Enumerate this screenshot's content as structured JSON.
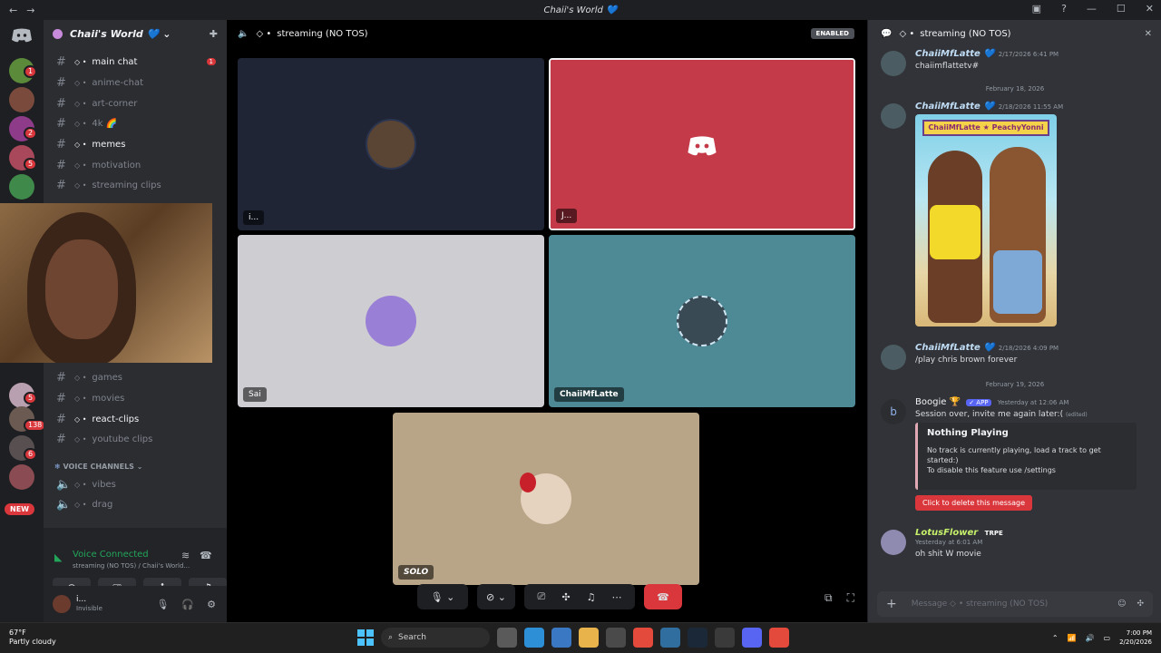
{
  "window": {
    "title": "Chaii's World 💙"
  },
  "guild": {
    "name": "Chaii's World 💙"
  },
  "servers": {
    "badges": [
      "1",
      "2",
      "5",
      "5",
      "138",
      "6"
    ],
    "new_label": "NEW"
  },
  "channels": [
    {
      "name": "main chat",
      "bright": true,
      "unread": "1"
    },
    {
      "name": "anime-chat"
    },
    {
      "name": "art-corner"
    },
    {
      "name": "4k 🌈"
    },
    {
      "name": "memes",
      "bright": true
    },
    {
      "name": "motivation"
    },
    {
      "name": "streaming clips"
    },
    {
      "name": "games"
    },
    {
      "name": "movies"
    },
    {
      "name": "react-clips",
      "bright": true
    },
    {
      "name": "youtube clips"
    }
  ],
  "voice_category": "VOICE CHANNELS",
  "voice_channels": [
    "vibes",
    "drag"
  ],
  "voice_panel": {
    "status": "Voice Connected",
    "sub": "streaming (NO TOS) / Chaii's World..."
  },
  "user": {
    "name": "i...",
    "status": "Invisible"
  },
  "stage": {
    "channel": "streaming (NO TOS)",
    "enabled": "ENABLED",
    "tiles": [
      {
        "label": "i...",
        "bg": "#1f2535"
      },
      {
        "label": "J...",
        "bg": "#c43a48"
      },
      {
        "label": "Sai",
        "bg": "#cdcdd2"
      },
      {
        "label": "ChaiiMfLatte",
        "bg": "#4e8a96"
      },
      {
        "label": "SOLO",
        "bg": "#b8a486"
      }
    ]
  },
  "chat": {
    "header": "streaming (NO TOS)",
    "messages": [
      {
        "author": "ChaiiMfLatte 💙",
        "time": "2/17/2026 6:41 PM",
        "text": "chaiimflattetv#"
      },
      {
        "date": "February 18, 2026"
      },
      {
        "author": "ChaiiMfLatte 💙",
        "time": "2/18/2026 11:55 AM",
        "text": ""
      },
      {
        "author": "ChaiiMfLatte 💙",
        "time": "2/18/2026 4:09 PM",
        "text": "/play chris brown forever"
      },
      {
        "date": "February 19, 2026"
      },
      {
        "author": "Boogie 🏆",
        "app": "✓ APP",
        "time": "Yesterday at 12:06 AM",
        "text": "Session over, invite me again later:(",
        "edited": "(edited)"
      },
      {
        "author": "LotusFlower",
        "tag": "TRPE",
        "time": "Yesterday at 6:01 AM",
        "text": "oh shit W movie"
      }
    ],
    "art_banner": "ChaiiMfLatte ★ PeachyYonni",
    "embed": {
      "title": "Nothing Playing",
      "desc1": "No track is currently playing, load a track to get started:)",
      "desc2": "To disable this feature use /settings"
    },
    "delete_btn": "Click to delete this message",
    "input_placeholder": "Message ◇ • streaming (NO TOS)"
  },
  "taskbar": {
    "weather_temp": "67°F",
    "weather": "Partly cloudy",
    "search": "Search",
    "time": "7:00 PM",
    "date": "2/20/2026"
  }
}
